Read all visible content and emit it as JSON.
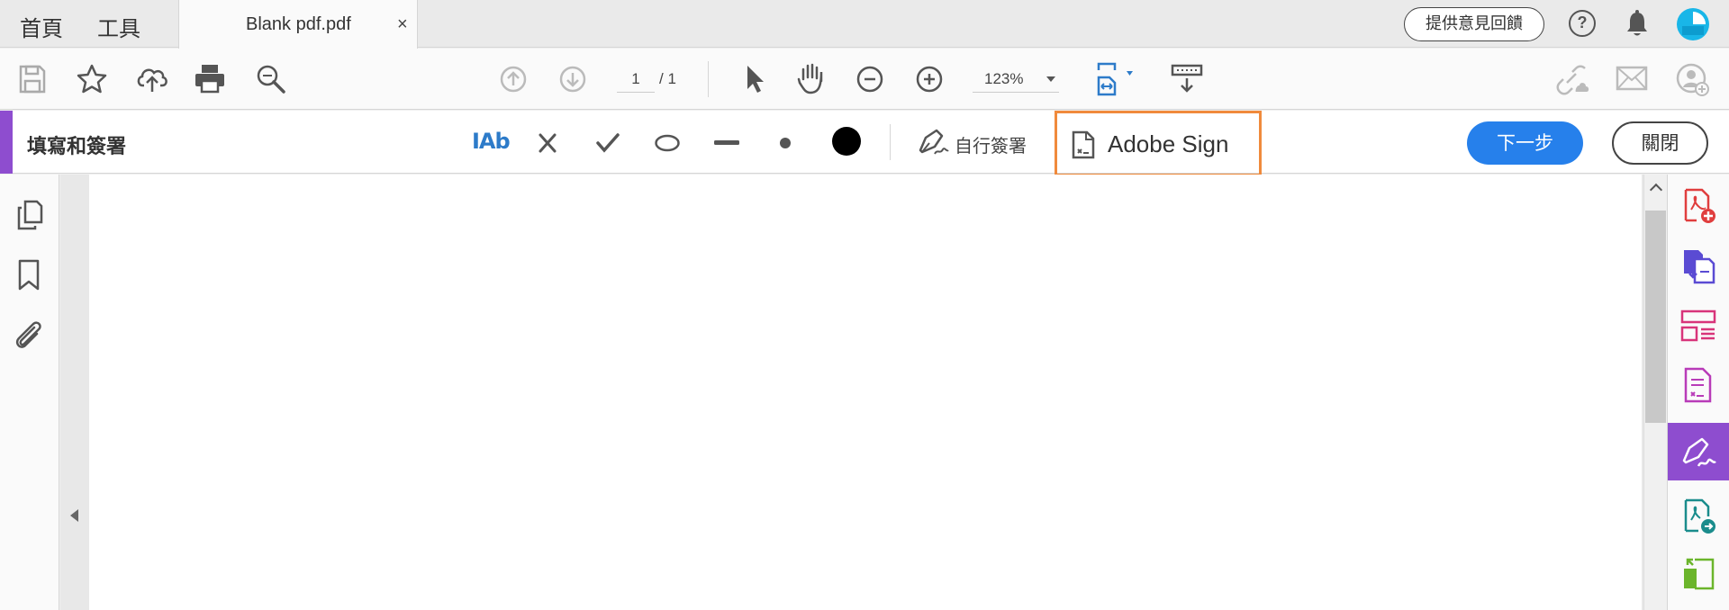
{
  "tabs": {
    "home": "首頁",
    "tools": "工具",
    "document": "Blank pdf.pdf",
    "close_symbol": "×"
  },
  "header": {
    "feedback_label": "提供意見回饋",
    "help_symbol": "?"
  },
  "toolbar": {
    "page_current": "1",
    "page_total": "/ 1",
    "zoom": "123%"
  },
  "fill_sign": {
    "title": "填寫和簽署",
    "text_tool": "IAb",
    "self_sign": "自行簽署",
    "adobe_sign": "Adobe Sign",
    "next_button": "下一步",
    "close_button": "關閉"
  },
  "icons": {
    "toolbar_left": [
      "save-icon",
      "star-icon",
      "cloud-upload-icon",
      "print-icon",
      "search-zoom-icon"
    ],
    "toolbar_nav": [
      "page-up-icon",
      "page-down-icon"
    ],
    "toolbar_tools": [
      "select-arrow-icon",
      "hand-icon",
      "zoom-out-icon",
      "zoom-in-icon",
      "fit-page-icon",
      "read-mode-icon"
    ],
    "toolbar_right": [
      "share-link-icon",
      "email-icon",
      "add-user-icon"
    ],
    "left_panel": [
      "pages-icon",
      "bookmark-icon",
      "attachment-icon"
    ],
    "right_panel": [
      "create-pdf-icon",
      "export-pdf-icon",
      "organize-pages-icon",
      "edit-pdf-icon",
      "fill-sign-icon",
      "send-for-review-icon",
      "compress-icon"
    ]
  },
  "colors": {
    "accent_purple": "#8e4dcf",
    "primary_blue": "#2680eb",
    "highlight_orange": "#f08a3c",
    "tool_blue": "#2d7bc9"
  }
}
